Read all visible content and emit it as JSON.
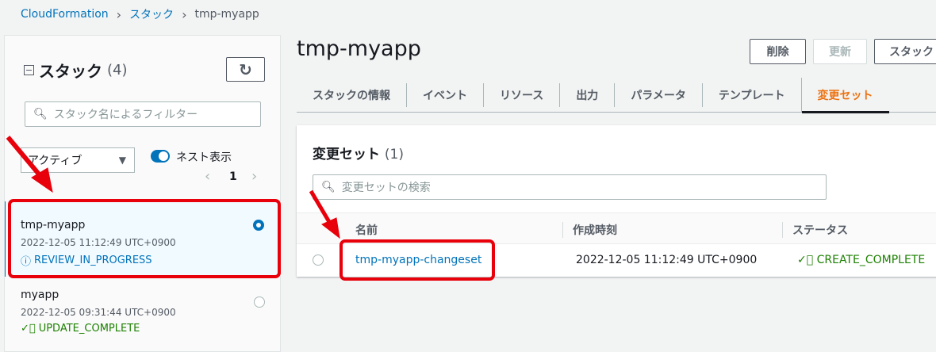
{
  "breadcrumb": [
    "CloudFormation",
    "スタック",
    "tmp-myapp"
  ],
  "sidebar": {
    "title": "スタック",
    "count": "(4)",
    "filter_placeholder": "スタック名によるフィルター",
    "status_filter": "アクティブ",
    "nested_label": "ネスト表示",
    "page": "1",
    "stacks": [
      {
        "name": "tmp-myapp",
        "date": "2022-12-05 11:12:49 UTC+0900",
        "status": "REVIEW_IN_PROGRESS",
        "selected": true
      },
      {
        "name": "myapp",
        "date": "2022-12-05 09:31:44 UTC+0900",
        "status": "UPDATE_COMPLETE",
        "selected": false
      }
    ]
  },
  "main": {
    "title": "tmp-myapp",
    "buttons": {
      "delete": "削除",
      "update": "更新",
      "stack_actions": "スタック"
    },
    "tabs": [
      "スタックの情報",
      "イベント",
      "リソース",
      "出力",
      "パラメータ",
      "テンプレート",
      "変更セット"
    ],
    "changesets": {
      "title": "変更セット",
      "count": "(1)",
      "search_placeholder": "変更セットの検索",
      "columns": [
        "名前",
        "作成時刻",
        "ステータス"
      ],
      "rows": [
        {
          "name": "tmp-myapp-changeset",
          "created": "2022-12-05 11:12:49 UTC+0900",
          "status": "CREATE_COMPLETE"
        }
      ]
    }
  },
  "colors": {
    "link": "#0073bb",
    "active_tab": "#ec7211",
    "success": "#1d8102",
    "highlight": "#e8000b"
  }
}
